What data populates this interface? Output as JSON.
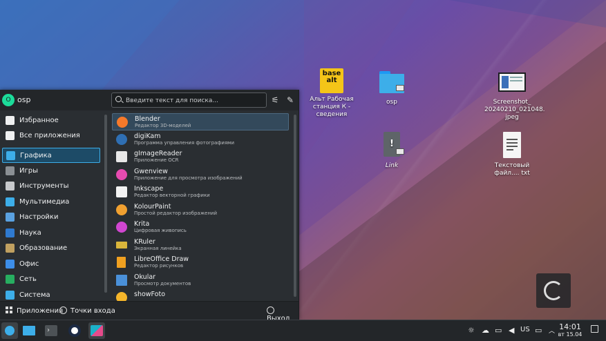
{
  "desktop": {
    "icons": [
      {
        "label": "Альт Рабочая станция К - сведения",
        "icon": "basealt-logo-icon",
        "logo_text": "base alt"
      },
      {
        "label": "osp",
        "icon": "folder-icon"
      },
      {
        "label": "Link",
        "icon": "broken-link-icon"
      },
      {
        "label": "Screenshot_ 20240210_021048. jpeg",
        "icon": "image-file-icon"
      },
      {
        "label": "Текстовый файл.... txt",
        "icon": "text-file-icon"
      }
    ]
  },
  "menu": {
    "user": {
      "initial": "O",
      "name": "osp"
    },
    "search": {
      "placeholder": "Введите текст для поиска..."
    },
    "categories": [
      {
        "label": "Избранное",
        "icon": "bookmark-icon",
        "color": "#eff0f1"
      },
      {
        "label": "Все приложения",
        "icon": "apps-grid-icon",
        "color": "#eff0f1"
      },
      {
        "label": "Графика",
        "icon": "graphics-icon",
        "color": "#3daee9",
        "selected": true
      },
      {
        "label": "Игры",
        "icon": "games-icon",
        "color": "#8a8f94"
      },
      {
        "label": "Инструменты",
        "icon": "tools-icon",
        "color": "#c7c9cc"
      },
      {
        "label": "Мультимедиа",
        "icon": "multimedia-icon",
        "color": "#3daee9"
      },
      {
        "label": "Настройки",
        "icon": "settings-icon",
        "color": "#5aa1e0"
      },
      {
        "label": "Наука",
        "icon": "science-icon",
        "color": "#2f7ad0"
      },
      {
        "label": "Образование",
        "icon": "education-icon",
        "color": "#c0a060"
      },
      {
        "label": "Офис",
        "icon": "office-icon",
        "color": "#3d8ee9"
      },
      {
        "label": "Сеть",
        "icon": "network-icon",
        "color": "#27ae60"
      },
      {
        "label": "Система",
        "icon": "system-icon",
        "color": "#3daee9"
      }
    ],
    "apps": [
      {
        "name": "Blender",
        "desc": "Редактор 3D-моделей",
        "icon": "blender-icon",
        "color": "#f5792a",
        "selected": true
      },
      {
        "name": "digiKam",
        "desc": "Программа управления фотографиями",
        "icon": "digikam-icon",
        "color": "#2f6fb3"
      },
      {
        "name": "gImageReader",
        "desc": "Приложение OCR",
        "icon": "gimagereader-icon",
        "color": "#e8e8e8"
      },
      {
        "name": "Gwenview",
        "desc": "Приложение для просмотра изображений",
        "icon": "gwenview-icon",
        "color": "#e64bb0"
      },
      {
        "name": "Inkscape",
        "desc": "Редактор векторной графики",
        "icon": "inkscape-icon",
        "color": "#f2f2f2"
      },
      {
        "name": "KolourPaint",
        "desc": "Простой редактор изображений",
        "icon": "kolourpaint-icon",
        "color": "#f0a030"
      },
      {
        "name": "Krita",
        "desc": "Цифровая живопись",
        "icon": "krita-icon",
        "color": "#d046d0"
      },
      {
        "name": "KRuler",
        "desc": "Экранная линейка",
        "icon": "kruler-icon",
        "color": "#d9b53b"
      },
      {
        "name": "LibreOffice Draw",
        "desc": "Редактор рисунков",
        "icon": "libreoffice-draw-icon",
        "color": "#f0a020"
      },
      {
        "name": "Okular",
        "desc": "Просмотр документов",
        "icon": "okular-icon",
        "color": "#4a90d9"
      },
      {
        "name": "showFoto",
        "desc": "",
        "icon": "showfoto-icon",
        "color": "#f5b52a"
      }
    ],
    "footer": {
      "applications": "Приложения",
      "places": "Точки входа",
      "leave": "Выход"
    }
  },
  "taskbar": {
    "launchers": [
      {
        "name": "app-launcher",
        "icon": "launcher-icon",
        "color": "#3daee9"
      },
      {
        "name": "file-manager",
        "icon": "folder-icon",
        "color": "#3daee9"
      },
      {
        "name": "terminal",
        "icon": "terminal-icon",
        "color": "#4d5256"
      },
      {
        "name": "browser",
        "icon": "browser-icon",
        "color": "#ffffff"
      },
      {
        "name": "spectacle",
        "icon": "screenshot-icon",
        "color": "#1cb0c8"
      }
    ],
    "keyboard_layout": "US",
    "time": "14:01",
    "date": "вт 15.04"
  }
}
